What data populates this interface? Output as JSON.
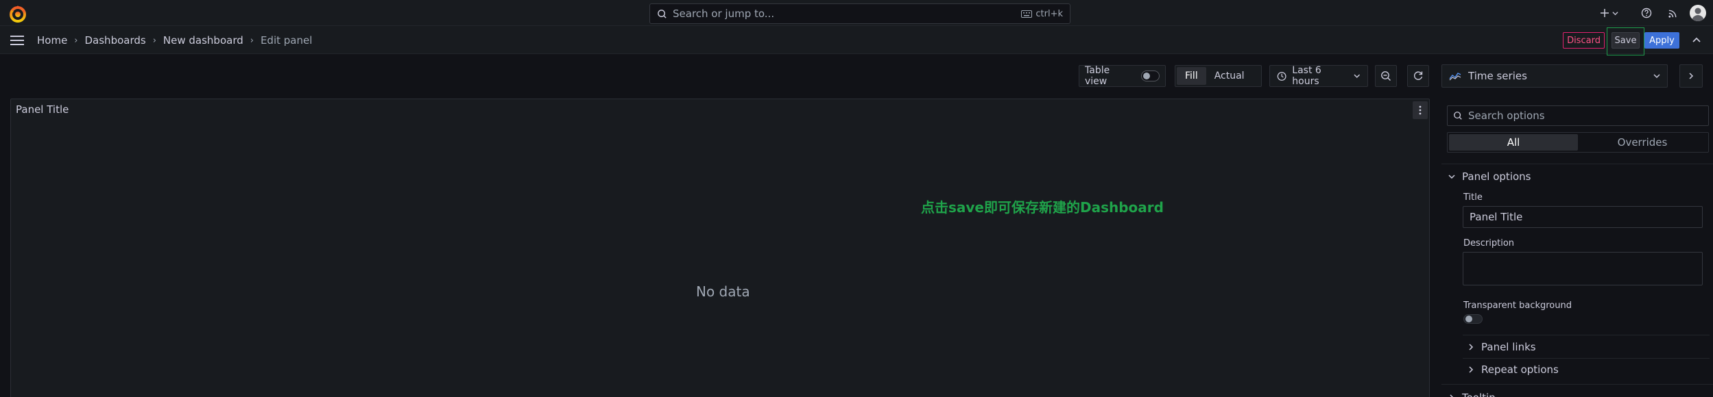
{
  "topbar": {
    "search_placeholder": "Search or jump to...",
    "shortcut": "ctrl+k",
    "new_icon": "plus-icon",
    "help_icon": "help-circle-icon",
    "news_icon": "rss-icon"
  },
  "breadcrumb": {
    "items": [
      "Home",
      "Dashboards",
      "New dashboard",
      "Edit panel"
    ],
    "separator": "›"
  },
  "actions": {
    "discard": "Discard",
    "save": "Save",
    "apply": "Apply"
  },
  "toolbar": {
    "table_view": "Table view",
    "fill": "Fill",
    "actual": "Actual",
    "time_range": "Last 6 hours"
  },
  "panel": {
    "title": "Panel Title",
    "no_data": "No data",
    "annotation": "点击save即可保存新建的Dashboard"
  },
  "options": {
    "visualization": "Time series",
    "search_placeholder": "Search options",
    "tabs": [
      "All",
      "Overrides"
    ],
    "section_title": "Panel options",
    "title_label": "Title",
    "title_value": "Panel Title",
    "description_label": "Description",
    "transparent_label": "Transparent background",
    "panel_links": "Panel links",
    "repeat_options": "Repeat options",
    "next_section": "Tooltip"
  },
  "colors": {
    "background": "#111217",
    "surface": "#181b1f",
    "primary": "#3d71d9",
    "discard": "#ff5286",
    "annotation": "#1fa34a"
  }
}
